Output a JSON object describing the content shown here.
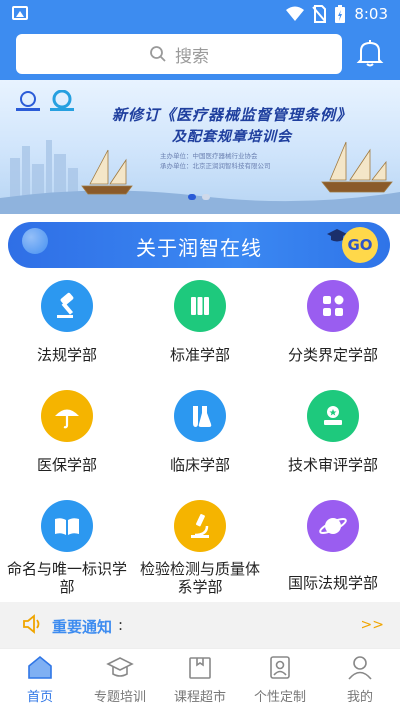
{
  "status_bar": {
    "time": "8:03",
    "icons": [
      "gallery-icon",
      "wifi-icon",
      "no-sim-icon",
      "battery-charging-icon"
    ]
  },
  "header": {
    "search_placeholder": "搜索",
    "search_icon": "search-icon",
    "bell_icon": "bell-icon"
  },
  "banner": {
    "title_line1": "新修订《医疗器械监督管理条例》",
    "title_line2": "及配套规章培训会",
    "host": "主办单位：中国医疗器械行业协会",
    "organizer": "承办单位：北京正润润智科技有限公司",
    "active_slide": 1,
    "slide_count": 2
  },
  "about": {
    "label": "关于润智在线",
    "go": "GO"
  },
  "departments": [
    {
      "label": "法规学部",
      "icon": "gavel-icon",
      "color": "#2c98f0"
    },
    {
      "label": "标准学部",
      "icon": "books-icon",
      "color": "#1ec97d"
    },
    {
      "label": "分类界定学部",
      "icon": "grid-icon",
      "color": "#9a5df0"
    },
    {
      "label": "医保学部",
      "icon": "umbrella-icon",
      "color": "#f5b400"
    },
    {
      "label": "临床学部",
      "icon": "flask-icon",
      "color": "#2c98f0"
    },
    {
      "label": "技术审评学部",
      "icon": "certificate-icon",
      "color": "#1ec97d"
    },
    {
      "label": "命名与唯一标识学部",
      "icon": "book-open-icon",
      "color": "#2c98f0"
    },
    {
      "label": "检验检测与质量体系学部",
      "icon": "microscope-icon",
      "color": "#f5b400"
    },
    {
      "label": "国际法规学部",
      "icon": "planet-icon",
      "color": "#9a5df0"
    }
  ],
  "notice": {
    "title": "重要通知",
    "colon": ":",
    "more": ">>"
  },
  "tabs": [
    {
      "label": "首页",
      "icon": "home-icon",
      "active": true
    },
    {
      "label": "专题培训",
      "icon": "graduation-cap-icon",
      "active": false
    },
    {
      "label": "课程超市",
      "icon": "store-icon",
      "active": false
    },
    {
      "label": "个性定制",
      "icon": "custom-icon",
      "active": false
    },
    {
      "label": "我的",
      "icon": "user-icon",
      "active": false
    }
  ]
}
